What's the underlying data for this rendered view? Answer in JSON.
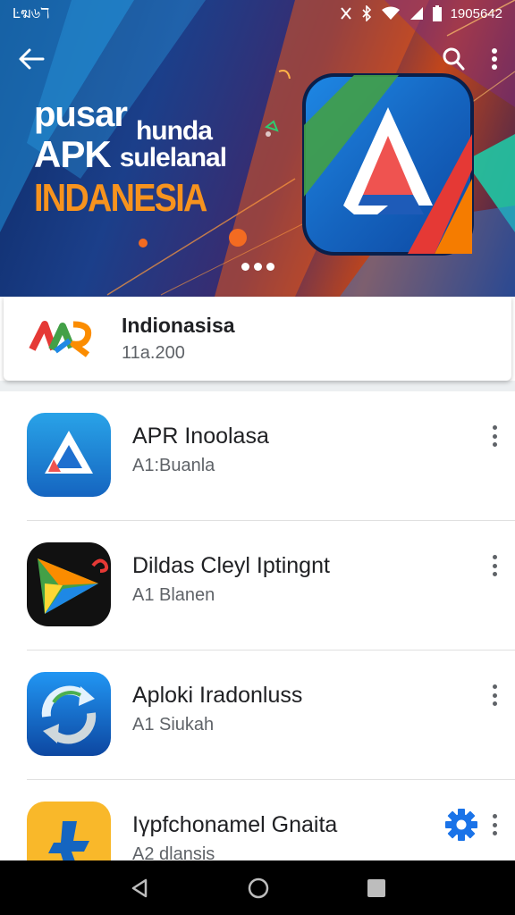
{
  "status_bar": {
    "left_text": "Ŀฆ৬ℸ",
    "right_text": "1905642"
  },
  "hero": {
    "line1_a": "pusar",
    "line1_b": "hunda",
    "line2_a": "APK",
    "line2_b": "sulelanal",
    "line3": "INDANESIA"
  },
  "featured": {
    "name": "Indionasisa",
    "sub": "11a.200"
  },
  "apps": [
    {
      "title": "APR Inoolasa",
      "subtitle": "A1:Buanla",
      "icon": "triangle-app-icon"
    },
    {
      "title": "Dildas Cleyl Iptingnt",
      "subtitle": "A1 Blanen",
      "icon": "play-arrow-app-icon"
    },
    {
      "title": "Aploki Iradonluss",
      "subtitle": "A1 Siukah",
      "icon": "sync-arrows-app-icon"
    },
    {
      "title": "Iγpfchonamel Gnaita",
      "subtitle": "A2 dlansis",
      "icon": "yellow-star-app-icon"
    }
  ],
  "colors": {
    "accent_orange": "#f7931e",
    "link_blue": "#1a73e8",
    "text_primary": "#202124",
    "text_secondary": "#5f6368"
  },
  "icons": {
    "back": "back-arrow-icon",
    "search": "search-icon",
    "more": "more-vert-icon",
    "settings": "gear-icon",
    "nav_back": "nav-back-icon",
    "nav_home": "nav-home-icon",
    "nav_recents": "nav-recents-icon"
  }
}
